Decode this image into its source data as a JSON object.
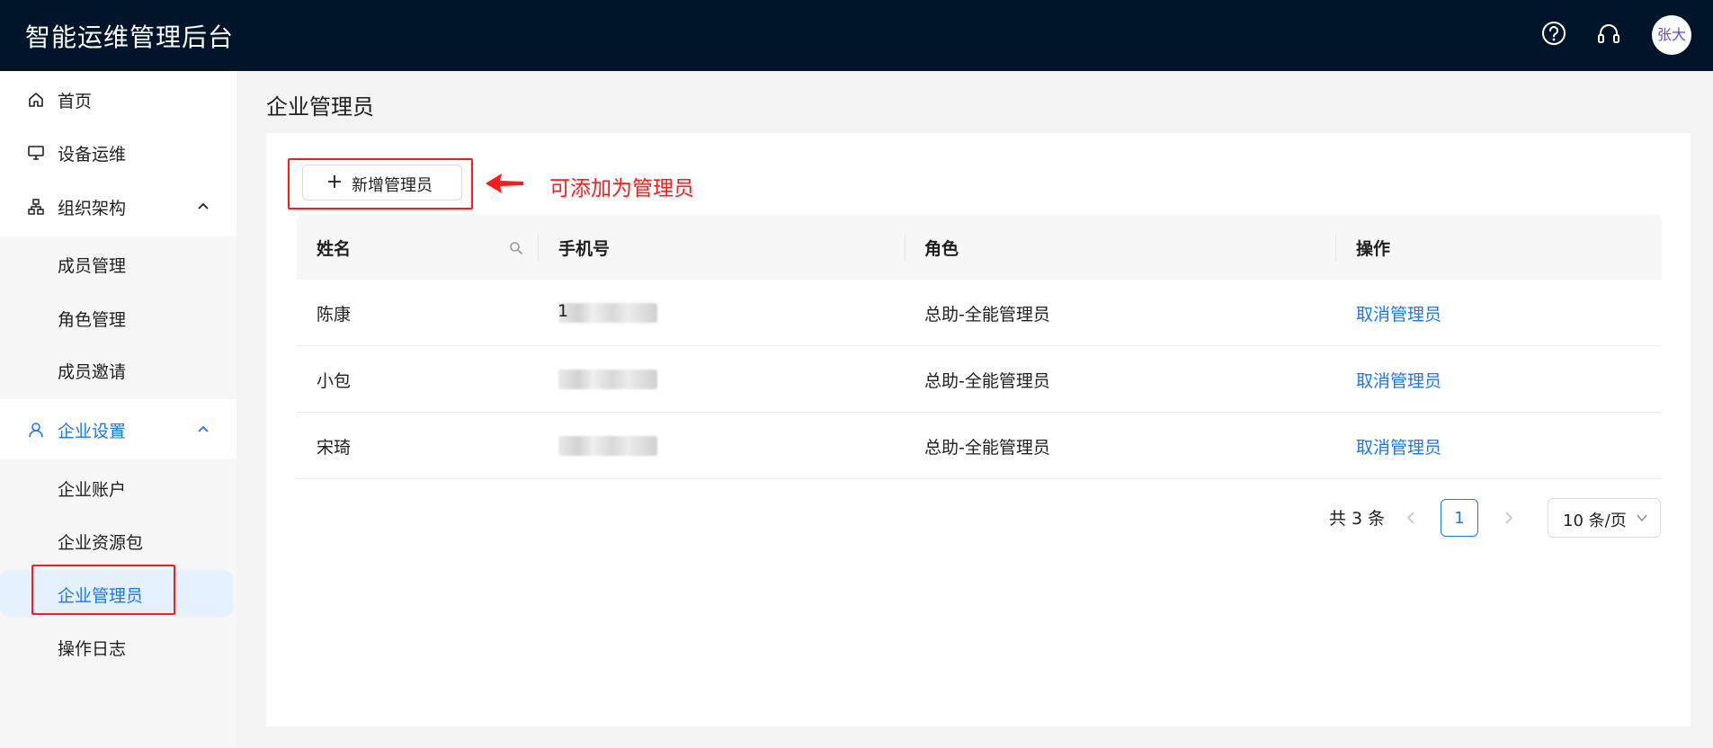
{
  "header": {
    "app_title": "智能运维管理后台",
    "avatar_text": "张大"
  },
  "sidebar": {
    "items": [
      {
        "label": "首页",
        "icon": "home-icon"
      },
      {
        "label": "设备运维",
        "icon": "monitor-icon"
      },
      {
        "label": "组织架构",
        "icon": "org-chart-icon",
        "expanded": true
      },
      {
        "label": "企业设置",
        "icon": "user-icon",
        "expanded": true,
        "active": true
      }
    ],
    "org_sub": [
      "成员管理",
      "角色管理",
      "成员邀请"
    ],
    "company_sub": [
      "企业账户",
      "企业资源包",
      "企业管理员",
      "操作日志"
    ],
    "selected": "企业管理员"
  },
  "page": {
    "title": "企业管理员"
  },
  "toolbar": {
    "add_label": "新增管理员"
  },
  "annotation": {
    "text": "可添加为管理员",
    "color": "#ff1a1a"
  },
  "table": {
    "headers": {
      "name": "姓名",
      "phone": "手机号",
      "role": "角色",
      "action": "操作"
    },
    "rows": [
      {
        "name": "陈康",
        "phone_prefix": "1",
        "role": "总助-全能管理员",
        "action": "取消管理员"
      },
      {
        "name": "小包",
        "phone_prefix": "",
        "role": "总助-全能管理员",
        "action": "取消管理员"
      },
      {
        "name": "宋琦",
        "phone_prefix": "",
        "role": "总助-全能管理员",
        "action": "取消管理员"
      }
    ]
  },
  "pagination": {
    "total": "共 3 条",
    "current": "1",
    "page_size": "10 条/页"
  },
  "colors": {
    "header_bg": "#001529",
    "primary": "#1677ff",
    "annotation": "#ff1a1a"
  }
}
